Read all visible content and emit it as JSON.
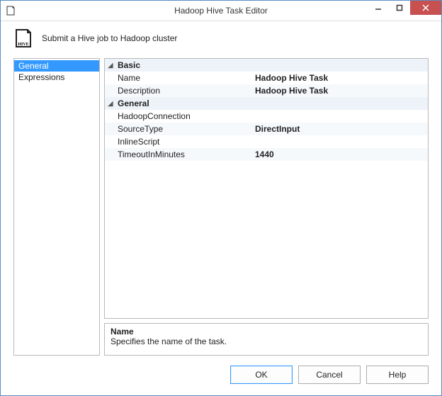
{
  "window": {
    "title": "Hadoop Hive Task Editor"
  },
  "header": {
    "text": "Submit a Hive job to Hadoop cluster",
    "icon_label": "HIVE"
  },
  "nav": {
    "items": [
      {
        "label": "General",
        "selected": true
      },
      {
        "label": "Expressions",
        "selected": false
      }
    ]
  },
  "property_grid": {
    "categories": [
      {
        "label": "Basic",
        "expanded": true,
        "properties": [
          {
            "name": "Name",
            "value": "Hadoop Hive Task"
          },
          {
            "name": "Description",
            "value": "Hadoop Hive Task"
          }
        ]
      },
      {
        "label": "General",
        "expanded": true,
        "properties": [
          {
            "name": "HadoopConnection",
            "value": ""
          },
          {
            "name": "SourceType",
            "value": "DirectInput"
          },
          {
            "name": "InlineScript",
            "value": ""
          },
          {
            "name": "TimeoutInMinutes",
            "value": "1440"
          }
        ]
      }
    ]
  },
  "description": {
    "title": "Name",
    "text": "Specifies the name of the task."
  },
  "buttons": {
    "ok": "OK",
    "cancel": "Cancel",
    "help": "Help"
  }
}
